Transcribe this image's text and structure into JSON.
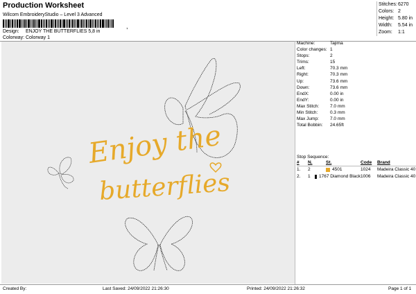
{
  "header": {
    "title": "Production Worksheet",
    "subtitle": "Wilcom EmbroideryStudio – Level 3 Advanced",
    "barcode_tail": ","
  },
  "meta": {
    "design_label": "Design:",
    "design_value": "ENJOY THE BUTTERFLIES 5,8 in",
    "colorway_label": "Colorway:",
    "colorway_value": "Colorway 1"
  },
  "stats": [
    {
      "label": "Stitches:",
      "value": "6270"
    },
    {
      "label": "Colors:",
      "value": "2"
    },
    {
      "label": "Height:",
      "value": "5.80 in"
    },
    {
      "label": "Width:",
      "value": "5.54 in"
    },
    {
      "label": "Zoom:",
      "value": "1:1"
    }
  ],
  "design": {
    "line1": "Enjoy the",
    "line2": "butterflies"
  },
  "info": [
    {
      "label": "Machine:",
      "value": "Tajima"
    },
    {
      "label": "Color changes:",
      "value": "1"
    },
    {
      "label": "Stops:",
      "value": "2"
    },
    {
      "label": "Trims:",
      "value": "15"
    },
    {
      "label": "Left:",
      "value": "70.3 mm"
    },
    {
      "label": "Right:",
      "value": "70.3 mm"
    },
    {
      "label": "Up:",
      "value": "73.6 mm"
    },
    {
      "label": "Down:",
      "value": "73.6 mm"
    },
    {
      "label": "EndX:",
      "value": "0.00 in"
    },
    {
      "label": "EndY:",
      "value": "0.00 in"
    },
    {
      "label": "Max Stitch:",
      "value": "7.0 mm"
    },
    {
      "label": "Min Stitch:",
      "value": "0.3 mm"
    },
    {
      "label": "Max Jump:",
      "value": "7.0 mm"
    },
    {
      "label": "Total Bobbin:",
      "value": "24.65ft"
    }
  ],
  "stop_sequence": {
    "title": "Stop Sequence:",
    "columns": [
      "#",
      "N.",
      "St.",
      "Code",
      "Brand"
    ],
    "rows": [
      {
        "num": "1.",
        "n": "2",
        "color": "#e6a92a",
        "st": "4501",
        "code": "1024",
        "brand": "Madeira Classic 40"
      },
      {
        "num": "2.",
        "n": "1",
        "color": "#111111",
        "st": "1767",
        "st_name": "Diamond Black",
        "code": "1006",
        "brand": "Madeira Classic 40"
      }
    ]
  },
  "footer": {
    "created_by": "Created By:",
    "last_saved": "Last Saved: 24/09/2022 21:26:30",
    "printed": "Printed: 24/09/2022 21:26:32",
    "page": "Page 1 of 1"
  },
  "colors": {
    "thread_gold": "#e6a92a",
    "thread_black": "#111111",
    "canvas_bg": "#ececec"
  }
}
